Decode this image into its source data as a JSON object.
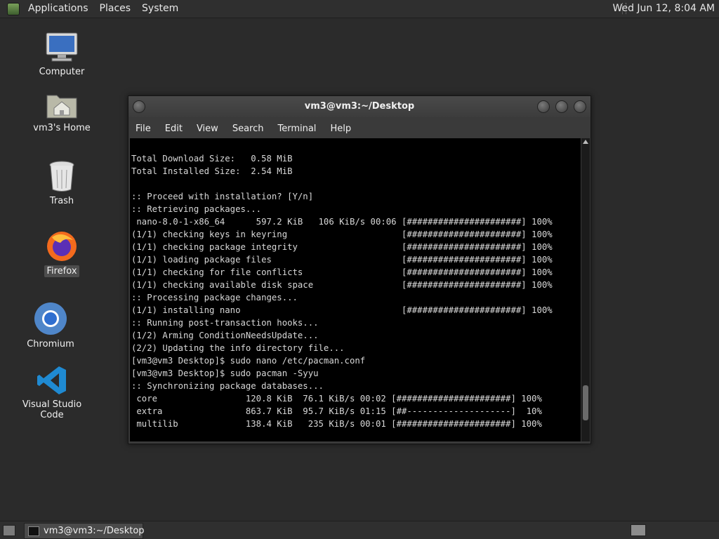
{
  "top_panel": {
    "menu": [
      "Applications",
      "Places",
      "System"
    ],
    "clock": "Wed Jun 12,  8:04 AM"
  },
  "desktop_icons": [
    {
      "label": "Computer",
      "icon": "computer-icon"
    },
    {
      "label": "vm3's Home",
      "icon": "home-folder-icon"
    },
    {
      "label": "Trash",
      "icon": "trash-icon"
    },
    {
      "label": "Firefox",
      "icon": "firefox-icon"
    },
    {
      "label": "Chromium",
      "icon": "chromium-icon"
    },
    {
      "label": "Visual Studio Code",
      "icon": "vscode-icon"
    }
  ],
  "terminal": {
    "title": "vm3@vm3:~/Desktop",
    "menu": [
      "File",
      "Edit",
      "View",
      "Search",
      "Terminal",
      "Help"
    ],
    "lines": [
      "",
      "Total Download Size:   0.58 MiB",
      "Total Installed Size:  2.54 MiB",
      "",
      ":: Proceed with installation? [Y/n]",
      ":: Retrieving packages...",
      " nano-8.0-1-x86_64      597.2 KiB   106 KiB/s 00:06 [######################] 100%",
      "(1/1) checking keys in keyring                      [######################] 100%",
      "(1/1) checking package integrity                    [######################] 100%",
      "(1/1) loading package files                         [######################] 100%",
      "(1/1) checking for file conflicts                   [######################] 100%",
      "(1/1) checking available disk space                 [######################] 100%",
      ":: Processing package changes...",
      "(1/1) installing nano                               [######################] 100%",
      ":: Running post-transaction hooks...",
      "(1/2) Arming ConditionNeedsUpdate...",
      "(2/2) Updating the info directory file...",
      "[vm3@vm3 Desktop]$ sudo nano /etc/pacman.conf",
      "[vm3@vm3 Desktop]$ sudo pacman -Syyu",
      ":: Synchronizing package databases...",
      " core                 120.8 KiB  76.1 KiB/s 00:02 [######################] 100%",
      " extra                863.7 KiB  95.7 KiB/s 01:15 [##--------------------]  10%",
      " multilib             138.4 KiB   235 KiB/s 00:01 [######################] 100%"
    ],
    "scroll_position": 0.93
  },
  "taskbar": {
    "task_label": "vm3@vm3:~/Desktop"
  }
}
